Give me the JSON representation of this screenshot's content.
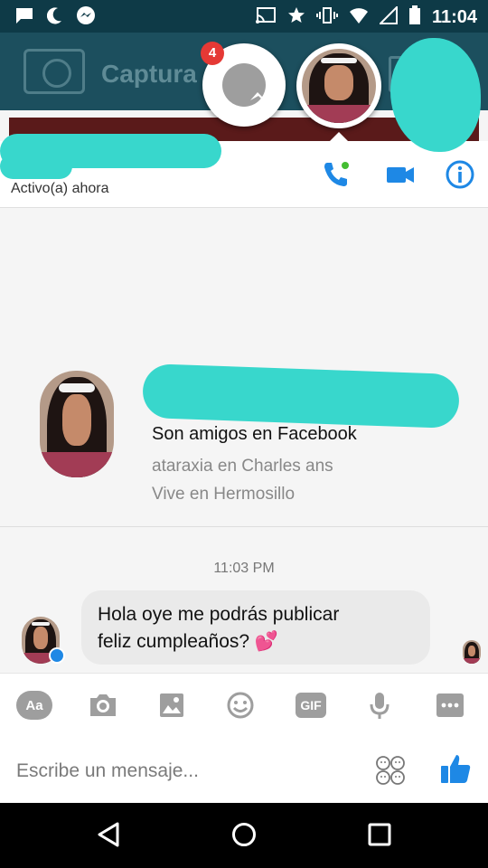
{
  "status_bar": {
    "time": "11:04",
    "left_icons": [
      "message-icon",
      "moon-icon",
      "messenger-icon"
    ],
    "right_icons": [
      "cast-icon",
      "star-icon",
      "vibrate-icon",
      "wifi-icon",
      "signal-icon",
      "battery-icon"
    ]
  },
  "background_app": {
    "title": "Captura"
  },
  "chat_heads": {
    "messenger_badge": "4"
  },
  "chat_header": {
    "status": "Activo(a) ahora",
    "actions": [
      "call-icon",
      "video-call-icon",
      "info-icon"
    ]
  },
  "profile_card": {
    "line1": "Son amigos en Facebook",
    "line2": "ataraxia en Charles ans",
    "line3": "Vive en Hermosillo"
  },
  "conversation": {
    "timestamp": "11:03 PM",
    "messages": [
      {
        "line1": "Hola oye me podrás publicar",
        "line2": "feliz cumpleaños? 💕"
      }
    ]
  },
  "toolbar": {
    "text_button": "Aa",
    "gif_button": "GIF",
    "icons": [
      "text-format-icon",
      "camera-icon",
      "gallery-icon",
      "emoji-icon",
      "gif-icon",
      "microphone-icon",
      "more-icon"
    ]
  },
  "composer": {
    "placeholder": "Escribe un mensaje...",
    "icons": [
      "stickers-icon",
      "like-icon"
    ]
  },
  "navigation": {
    "icons": [
      "back-icon",
      "home-icon",
      "recents-icon"
    ]
  },
  "colors": {
    "accent": "#1e88e5",
    "online": "#44bd32",
    "redaction": "#38d7cc",
    "status_bar": "#0e3a47"
  }
}
